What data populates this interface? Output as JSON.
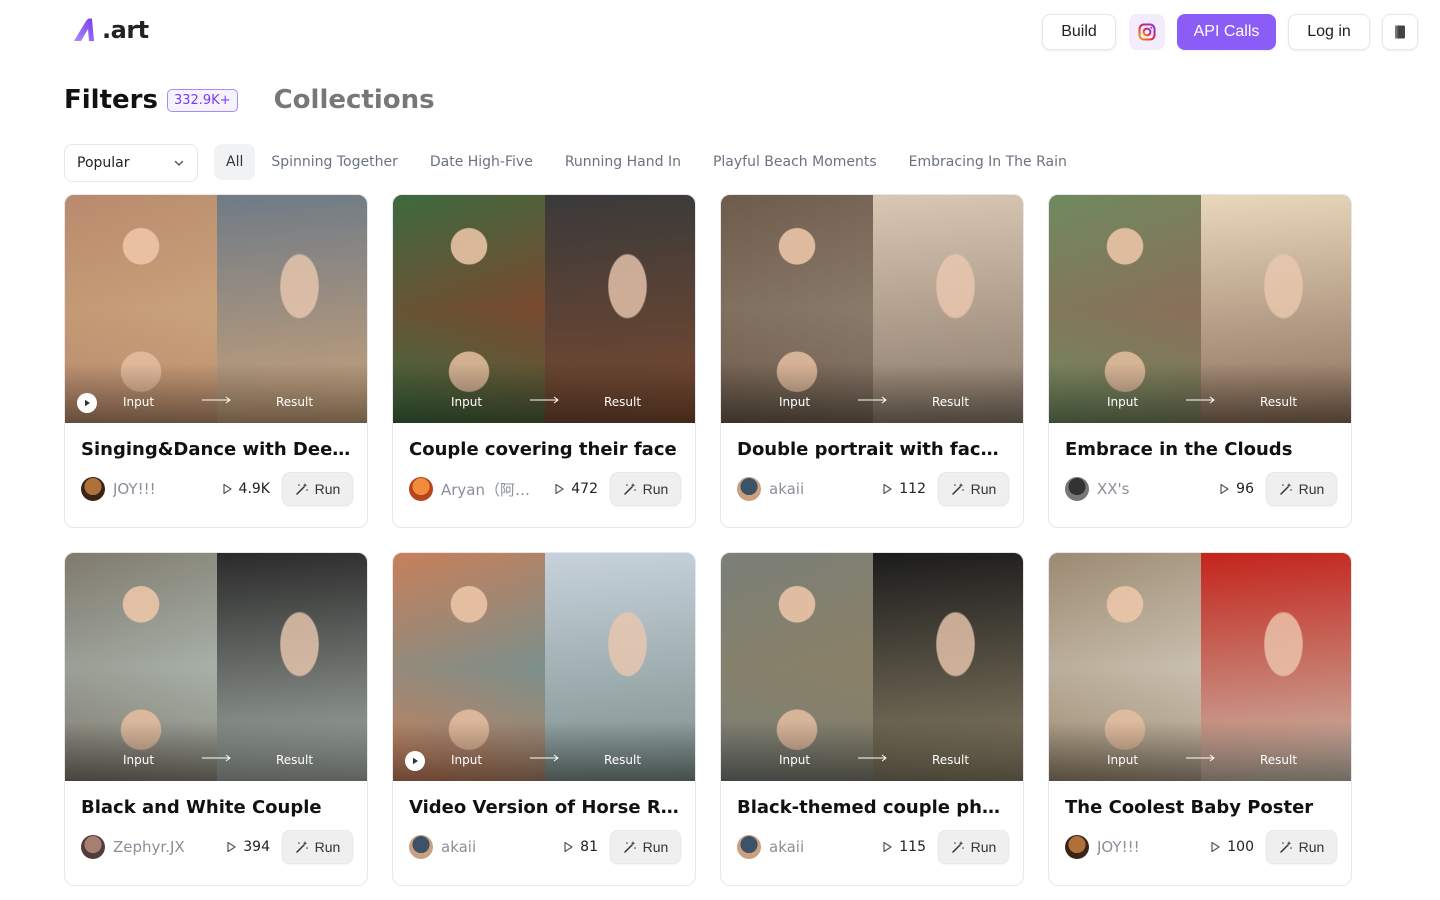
{
  "header": {
    "logo_text": ".art",
    "build_label": "Build",
    "instagram_icon": "instagram-icon",
    "api_label": "API Calls",
    "login_label": "Log in",
    "book_icon": "book-icon",
    "accent": "#8b5cf6"
  },
  "tabs": {
    "filters_label": "Filters",
    "filters_count": "332.9K+",
    "collections_label": "Collections"
  },
  "sort": {
    "selected": "Popular"
  },
  "chips": [
    {
      "label": "All",
      "active": true
    },
    {
      "label": "Spinning Together",
      "active": false
    },
    {
      "label": "Date High-Five",
      "active": false
    },
    {
      "label": "Running Hand In",
      "active": false
    },
    {
      "label": "Playful Beach Moments",
      "active": false
    },
    {
      "label": "Embracing In The Rain",
      "active": false
    }
  ],
  "thumb_labels": {
    "input": "Input",
    "result": "Result"
  },
  "run_label": "Run",
  "cards": [
    {
      "title": "Singing&Dance with Deep Sea",
      "author": "JOY!!!",
      "runs": "4.9K",
      "video": true,
      "colors": [
        "#b98a6d",
        "#c9a27a",
        "#6f7b86"
      ],
      "avatar": [
        "#b0703a",
        "#3a2418"
      ]
    },
    {
      "title": "Couple covering their face",
      "author": "Aryan（阿扬）",
      "runs": "472",
      "video": false,
      "colors": [
        "#3d6a3f",
        "#7a4a30",
        "#3a3a3a"
      ],
      "avatar": [
        "#f28b3c",
        "#b7441d"
      ]
    },
    {
      "title": "Double portrait with face touch",
      "author": "akaii",
      "runs": "112",
      "video": false,
      "colors": [
        "#6d5b4c",
        "#8a7a6a",
        "#d9c7b4"
      ],
      "avatar": [
        "#3c5266",
        "#caa080"
      ]
    },
    {
      "title": "Embrace in the Clouds",
      "author": "XX's",
      "runs": "96",
      "video": false,
      "colors": [
        "#6f8a5e",
        "#8a6f5a",
        "#e9d7bd"
      ],
      "avatar": [
        "#333333",
        "#777777"
      ]
    },
    {
      "title": "Black and White Couple",
      "author": "Zephyr.JX",
      "runs": "394",
      "video": false,
      "colors": [
        "#7f7a6d",
        "#a7b0a8",
        "#2a2a2a"
      ],
      "avatar": [
        "#a58070",
        "#553c3c"
      ]
    },
    {
      "title": "Video Version of Horse Riding",
      "author": "akaii",
      "runs": "81",
      "video": true,
      "colors": [
        "#c87f5a",
        "#7c8f8a",
        "#c7d2dc"
      ],
      "avatar": [
        "#3c5266",
        "#caa080"
      ]
    },
    {
      "title": "Black-themed couple photo",
      "author": "akaii",
      "runs": "115",
      "video": false,
      "colors": [
        "#7a7f78",
        "#8a8066",
        "#1c1c1c"
      ],
      "avatar": [
        "#3c5266",
        "#caa080"
      ]
    },
    {
      "title": "The Coolest Baby Poster",
      "author": "JOY!!!",
      "runs": "100",
      "video": false,
      "colors": [
        "#9c8a72",
        "#c9bfae",
        "#c4241c"
      ],
      "avatar": [
        "#b0703a",
        "#3a2418"
      ]
    }
  ]
}
